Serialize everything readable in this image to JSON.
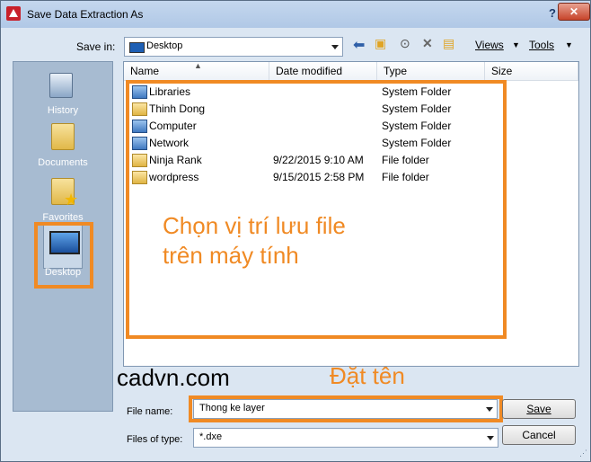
{
  "window": {
    "title": "Save Data Extraction As",
    "help": "?",
    "close": "✕"
  },
  "toolbar": {
    "save_in_label": "Save in:",
    "save_in_value": "Desktop",
    "views_label": "Views",
    "tools_label": "Tools",
    "icons": [
      "back-arrow-icon",
      "up-folder-icon",
      "search-web-icon",
      "delete-icon",
      "new-folder-icon"
    ]
  },
  "places": [
    {
      "label": "History",
      "icon": "history-icon"
    },
    {
      "label": "Documents",
      "icon": "documents-folder-icon"
    },
    {
      "label": "Favorites",
      "icon": "favorites-folder-icon"
    },
    {
      "label": "Desktop",
      "icon": "desktop-icon",
      "selected": true
    }
  ],
  "list": {
    "columns": [
      "Name",
      "Date modified",
      "Type",
      "Size"
    ],
    "rows": [
      {
        "name": "Libraries",
        "date": "",
        "type": "System Folder",
        "icon": "libraries-icon"
      },
      {
        "name": "Thinh Dong",
        "date": "",
        "type": "System Folder",
        "icon": "user-folder-icon"
      },
      {
        "name": "Computer",
        "date": "",
        "type": "System Folder",
        "icon": "computer-icon"
      },
      {
        "name": "Network",
        "date": "",
        "type": "System Folder",
        "icon": "network-icon"
      },
      {
        "name": "Ninja Rank",
        "date": "9/22/2015 9:10 AM",
        "type": "File folder",
        "icon": "folder-icon"
      },
      {
        "name": "wordpress",
        "date": "9/15/2015 2:58 PM",
        "type": "File folder",
        "icon": "folder-icon"
      }
    ]
  },
  "annotations": {
    "location_line1": "Chọn vị trí lưu file",
    "location_line2": "trên máy tính",
    "watermark": "cadvn.com",
    "name_hint": "Đặt tên",
    "color": "#f08a24"
  },
  "footer": {
    "file_name_label": "File name:",
    "file_name_value": "Thong ke layer",
    "file_type_label": "Files of type:",
    "file_type_value": "*.dxe",
    "save_label": "Save",
    "cancel_label": "Cancel"
  }
}
